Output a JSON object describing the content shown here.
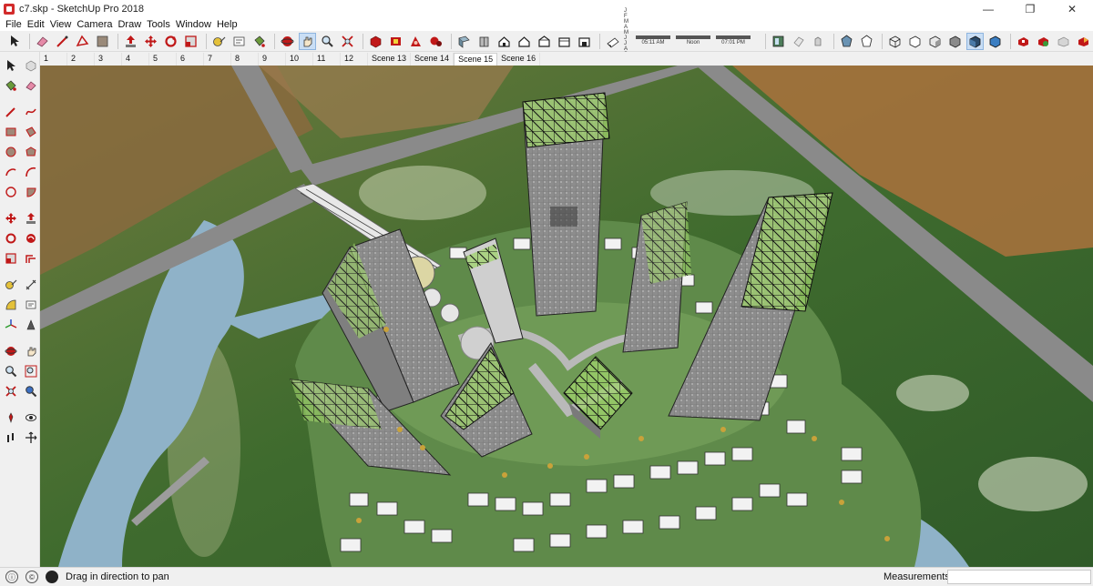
{
  "window": {
    "title": "c7.skp - SketchUp Pro 2018",
    "minimize": "—",
    "maximize": "❐",
    "close": "✕"
  },
  "menu": [
    "File",
    "Edit",
    "View",
    "Camera",
    "Draw",
    "Tools",
    "Window",
    "Help"
  ],
  "toolbar": {
    "icons": [
      "select-icon",
      "eraser-icon",
      "line-icon",
      "shapes-icon",
      "paint-icon",
      "push-pull-icon",
      "move-icon",
      "rotate-icon",
      "scale-icon",
      "offset-icon",
      "tape-measure-icon",
      "text-icon",
      "paint-bucket-icon",
      "orbit-icon",
      "pan-icon",
      "zoom-icon",
      "zoom-extents-icon",
      "3d-warehouse-icon",
      "extension-icon",
      "iso-view-icon",
      "top-view-icon",
      "front-view-icon",
      "right-view-icon",
      "back-view-icon",
      "left-view-icon",
      "x-ray-icon",
      "wireframe-icon",
      "hidden-line-icon",
      "shaded-icon",
      "shaded-textures-icon",
      "monochrome-icon"
    ],
    "shadow_months": "J F M A M J J A S O N D",
    "time_start": "05:11 AM",
    "time_noon": "Noon",
    "time_end": "07:01 PM"
  },
  "scenes": {
    "tabs": [
      "1",
      "2",
      "3",
      "4",
      "5",
      "6",
      "7",
      "8",
      "9",
      "10",
      "11",
      "12",
      "Scene 13",
      "Scene 14",
      "Scene 15",
      "Scene 16"
    ],
    "active": "Scene 15"
  },
  "status": {
    "hint": "Drag in direction to pan",
    "measurements_label": "Measurements",
    "measurements_value": ""
  },
  "colors": {
    "toolbar_bg": "#f0f0f0",
    "terrain": "#3d6a2e",
    "water": "#8fb2c8",
    "road": "#8a8a8a",
    "tower": "#8c8c8c",
    "glass": "#b7e07a"
  }
}
